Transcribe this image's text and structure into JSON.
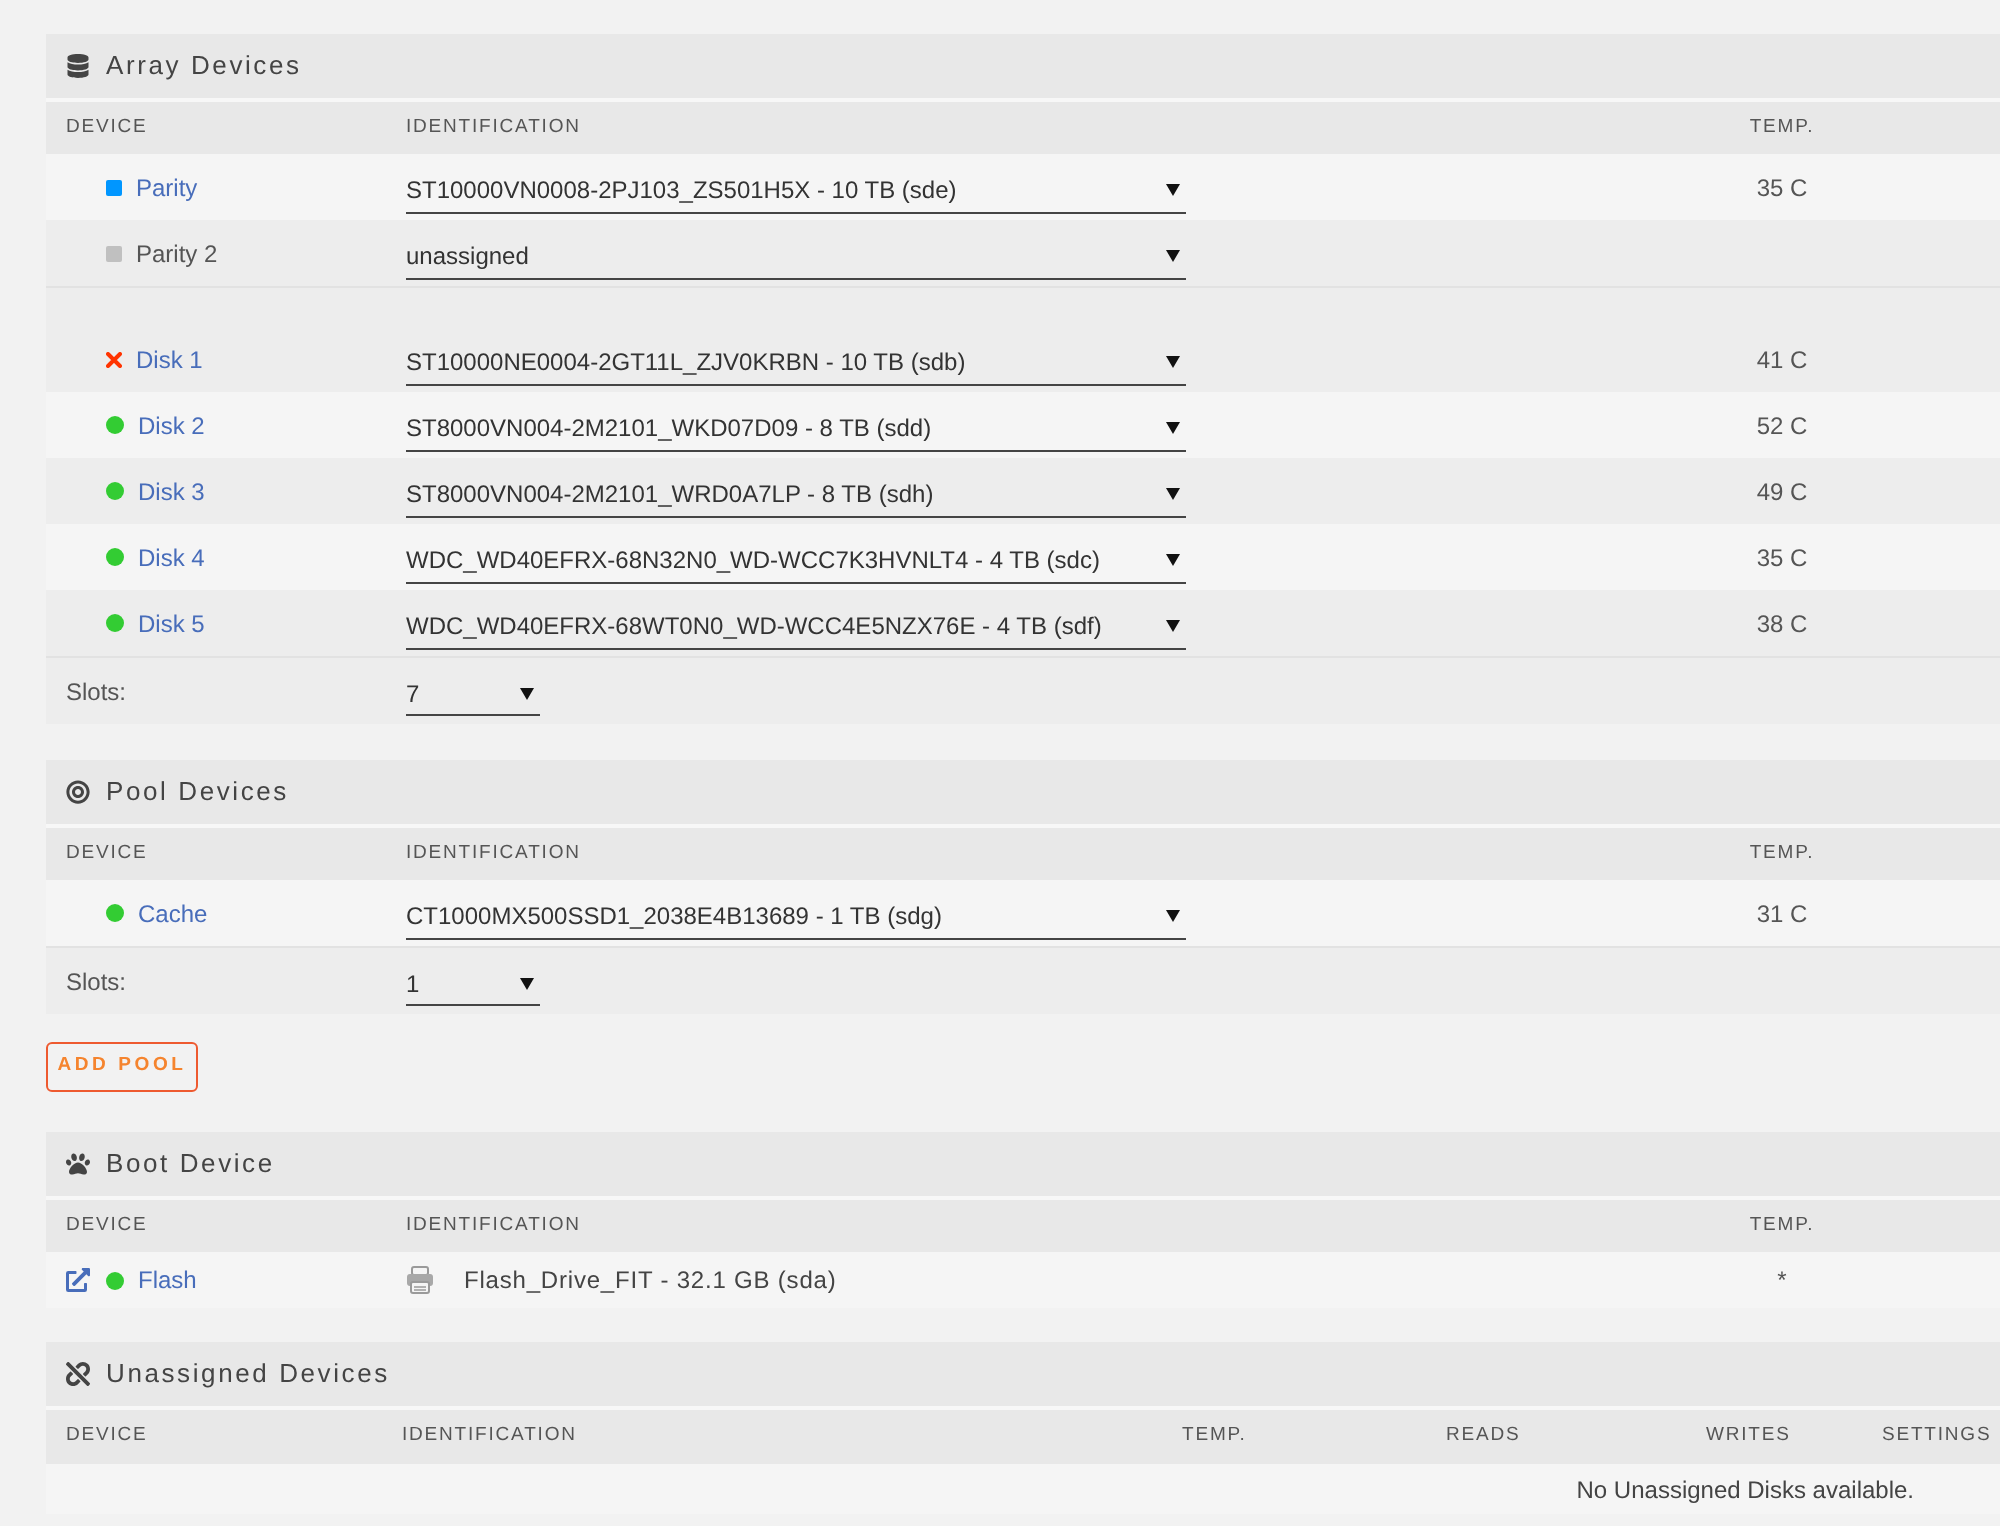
{
  "array_devices": {
    "title": "Array Devices",
    "columns": [
      "DEVICE",
      "IDENTIFICATION",
      "TEMP."
    ],
    "groups": [
      {
        "rows": [
          {
            "kind": "assignable",
            "device": "Parity",
            "status": {
              "kind": "square",
              "color": "#0096ff"
            },
            "link": true,
            "identification": "ST10000VN0008-2PJ103_ZS501H5X - 10 TB (sde)",
            "temp": "35 C"
          },
          {
            "kind": "assignable",
            "device": "Parity 2",
            "status": {
              "kind": "square",
              "color": "#c0c0c0"
            },
            "link": false,
            "identification": "unassigned"
          }
        ]
      },
      {
        "rows": [
          {
            "kind": "assignable",
            "device": "Disk 1",
            "status": {
              "kind": "cross",
              "color": "#ff3300"
            },
            "link": true,
            "identification": "ST10000NE0004-2GT11L_ZJV0KRBN - 10 TB (sdb)",
            "temp": "41 C"
          },
          {
            "kind": "assignable",
            "device": "Disk 2",
            "status": {
              "kind": "dot",
              "color": "#33cc33"
            },
            "link": true,
            "identification": "ST8000VN004-2M2101_WKD07D09 - 8 TB (sdd)",
            "temp": "52 C"
          },
          {
            "kind": "assignable",
            "device": "Disk 3",
            "status": {
              "kind": "dot",
              "color": "#33cc33"
            },
            "link": true,
            "identification": "ST8000VN004-2M2101_WRD0A7LP - 8 TB (sdh)",
            "temp": "49 C"
          },
          {
            "kind": "assignable",
            "device": "Disk 4",
            "status": {
              "kind": "dot",
              "color": "#33cc33"
            },
            "link": true,
            "identification": "WDC_WD40EFRX-68N32N0_WD-WCC7K3HVNLT4 - 4 TB (sdc)",
            "temp": "35 C"
          },
          {
            "kind": "assignable",
            "device": "Disk 5",
            "status": {
              "kind": "dot",
              "color": "#33cc33"
            },
            "link": true,
            "identification": "WDC_WD40EFRX-68WT0N0_WD-WCC4E5NZX76E - 4 TB (sdf)",
            "temp": "38 C"
          }
        ]
      }
    ],
    "slots": {
      "label": "Slots:",
      "value": "7"
    }
  },
  "pool_devices": {
    "title": "Pool Devices",
    "columns": [
      "DEVICE",
      "IDENTIFICATION",
      "TEMP."
    ],
    "groups": [
      {
        "rows": [
          {
            "kind": "assignable",
            "device": "Cache",
            "status": {
              "kind": "dot",
              "color": "#33cc33"
            },
            "link": true,
            "identification": "CT1000MX500SSD1_2038E4B13689 - 1 TB (sdg)",
            "temp": "31 C"
          }
        ]
      }
    ],
    "slots": {
      "label": "Slots:",
      "value": "1"
    }
  },
  "add_pool_button": "ADD POOL",
  "boot_device": {
    "title": "Boot Device",
    "columns": [
      "DEVICE",
      "IDENTIFICATION",
      "TEMP."
    ],
    "groups": [
      {
        "rows": [
          {
            "kind": "fixed",
            "device": "Flash",
            "status": {
              "kind": "dot",
              "color": "#33cc33"
            },
            "link": true,
            "identification": "Flash_Drive_FIT - 32.1 GB (sda)",
            "temp": "*"
          }
        ]
      }
    ]
  },
  "unassigned_devices": {
    "title": "Unassigned Devices",
    "columns": [
      "DEVICE",
      "IDENTIFICATION",
      "TEMP.",
      "READS",
      "WRITES",
      "SETTINGS"
    ],
    "empty_message": "No Unassigned Disks available."
  }
}
